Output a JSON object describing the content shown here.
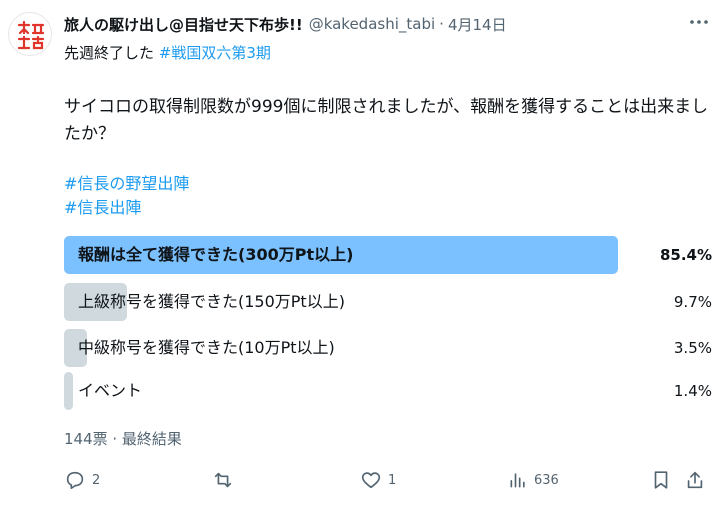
{
  "user": {
    "name": "旅人の駆け出し@目指せ天下布歩!!",
    "handle": "@kakedashi_tabi",
    "separator": "·",
    "date": "4月14日"
  },
  "post": {
    "line1_prefix": "先週終了した",
    "line1_tag": "#戦国双六第3期",
    "paragraph": "サイコロの取得制限数が999個に制限されましたが、報酬を獲得することは出来ましたか？",
    "tags": [
      "#信長の野望出陣",
      "#信長出陣"
    ]
  },
  "poll": {
    "options": [
      {
        "label": "報酬は全て獲得できた(300万Pt以上)",
        "percent_text": "85.4%",
        "percent": 85.4,
        "winner": true
      },
      {
        "label": "上級称号を獲得できた(150万Pt以上)",
        "percent_text": "9.7%",
        "percent": 9.7,
        "winner": false
      },
      {
        "label": "中級称号を獲得できた(10万Pt以上)",
        "percent_text": "3.5%",
        "percent": 3.5,
        "winner": false
      },
      {
        "label": "イベント",
        "percent_text": "1.4%",
        "percent": 1.4,
        "winner": false
      }
    ],
    "summary": "144票 · 最終結果"
  },
  "actions": {
    "replies": "2",
    "likes": "1",
    "views": "636"
  },
  "colors": {
    "winner_bar": "#7cc1ff",
    "loser_bar": "#cfd9de",
    "link": "#1d9bf0",
    "muted": "#536471",
    "avatar_red": "#e0352b"
  },
  "icons": [
    "avatar-logo",
    "more-icon",
    "reply-icon",
    "repost-icon",
    "like-icon",
    "views-icon",
    "bookmark-icon",
    "share-icon"
  ]
}
